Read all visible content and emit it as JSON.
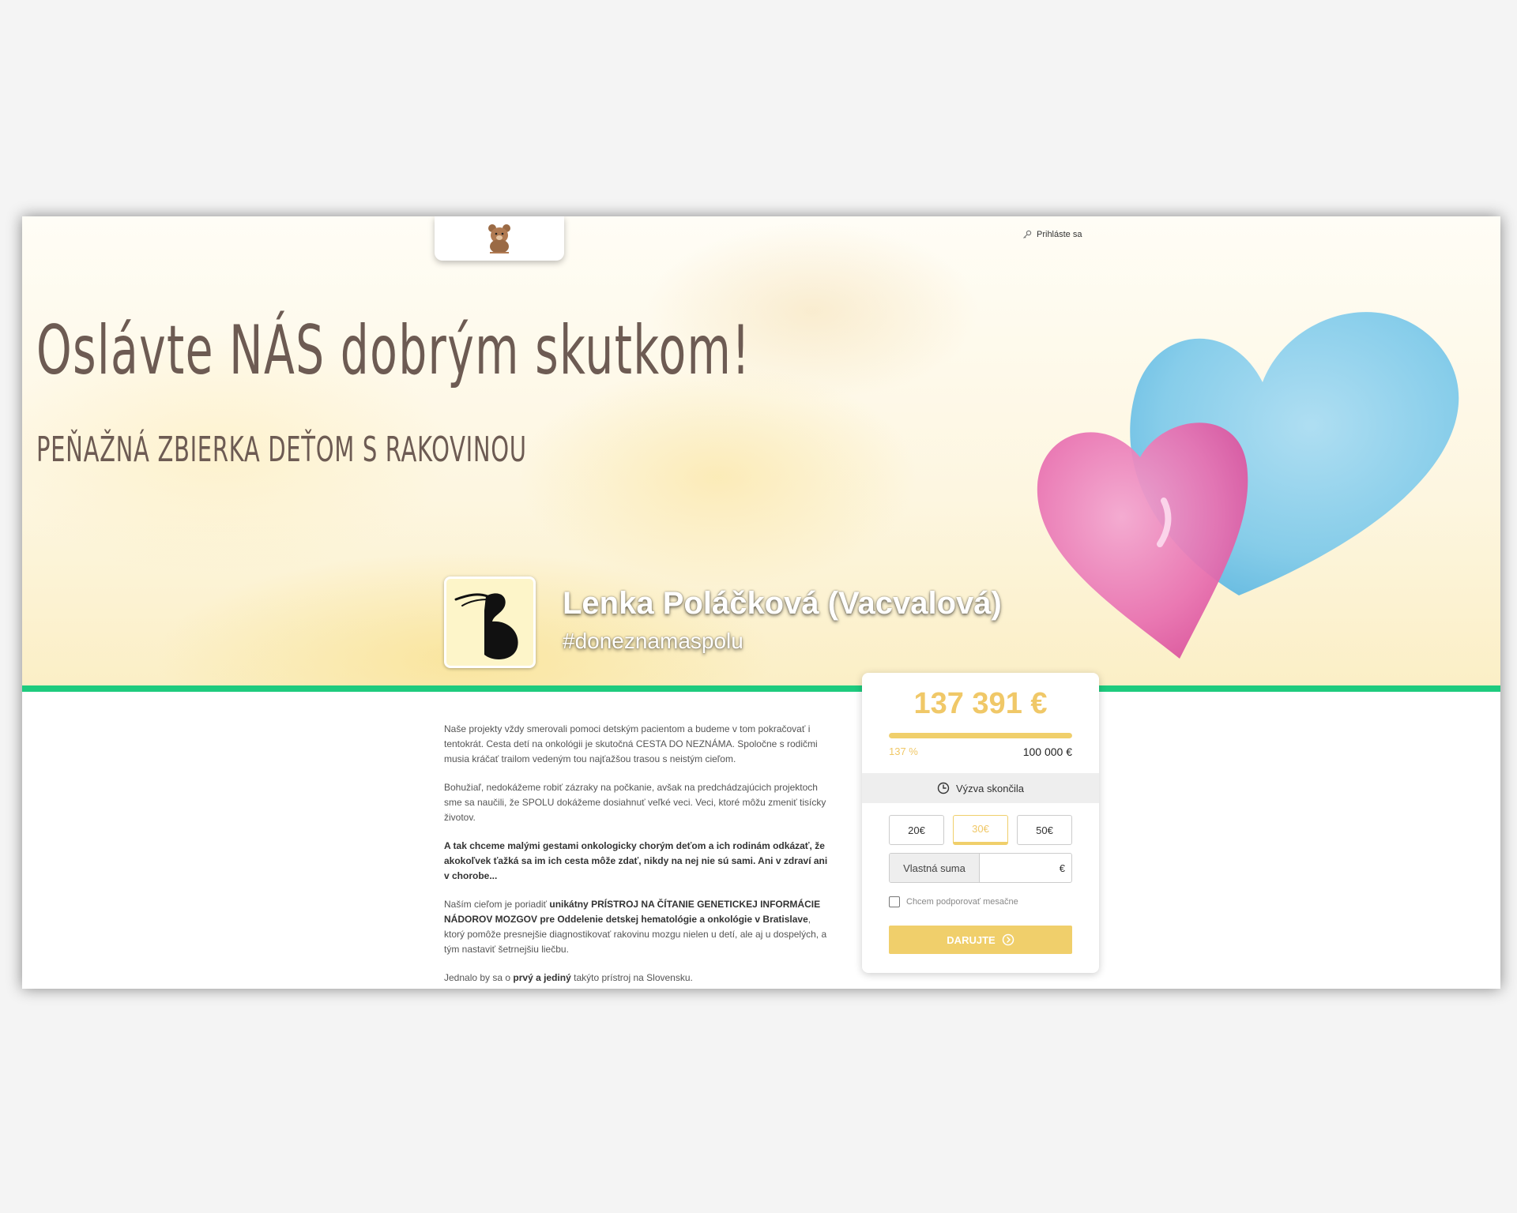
{
  "header": {
    "logo_alt_name": "Deťom s rakovinou",
    "login_label": "Prihláste sa"
  },
  "hero": {
    "title": "Oslávte NÁS dobrým skutkom!",
    "subtitle": "PEŇAŽNÁ ZBIERKA DEŤOM S RAKOVINOU"
  },
  "profile": {
    "name": "Lenka Poláčková (Vacvalová)",
    "hashtag": "#doneznamaspolu"
  },
  "content": {
    "p1": "Naše projekty vždy smerovali pomoci detským pacientom a budeme v tom pokračovať i tentokrát. Cesta detí na onkológii je skutočná CESTA DO NEZNÁMA. Spoločne s rodičmi musia kráčať trailom vedeným tou najťažšou trasou s neistým cieľom.",
    "p2": "Bohužiaľ, nedokážeme robiť zázraky na počkanie, avšak na predchádzajúcich projektoch sme sa naučili, že SPOLU dokážeme dosiahnuť veľké veci. Veci, ktoré môžu zmeniť tisícky životov.",
    "p3": "A tak chceme malými gestami onkologicky chorým deťom a ich rodinám odkázať, že akokoľvek ťažká sa im ich cesta môže zdať, nikdy na nej nie sú sami. Ani v zdraví ani v chorobe...",
    "p4_a": "Naším cieľom je poriadiť ",
    "p4_b": "unikátny PRÍSTROJ NA ČÍTANIE GENETICKEJ INFORMÁCIE NÁDOROV MOZGOV pre Oddelenie detskej hematológie a onkológie v Bratislave",
    "p4_c": ", ktorý pomôže presnejšie diagnostikovať rakovinu mozgu nielen u detí, ale aj u dospelých, a tým nastaviť šetrnejšiu liečbu.",
    "p5_a": "Jednalo by sa o ",
    "p5_b": "prvý a jediný",
    "p5_c": " takýto prístroj na Slovensku."
  },
  "donation": {
    "raised": "137 391 €",
    "progress_fraction": 1.0,
    "percent": "137 %",
    "goal": "100 000 €",
    "status": "Výzva skončila",
    "amounts": [
      "20€",
      "30€",
      "50€"
    ],
    "selected_amount_index": 1,
    "custom_label": "Vlastná suma",
    "currency": "€",
    "monthly_label": "Chcem podporovať mesačne",
    "donate_label": "DARUJTE"
  },
  "colors": {
    "accent_gold": "#f0cf6b",
    "green_bar": "#1ecb7e",
    "heart_blue": "#7cc9ea",
    "heart_pink": "#e86fb0"
  }
}
